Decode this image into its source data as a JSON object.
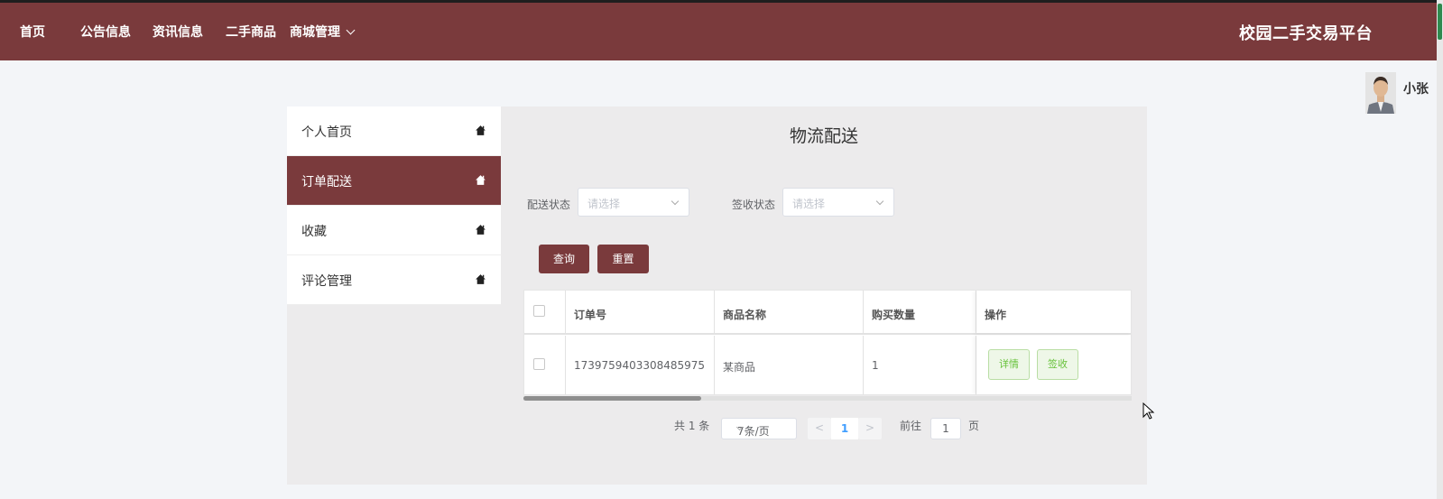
{
  "nav": {
    "home": "首页",
    "notice": "公告信息",
    "news": "资讯信息",
    "goods": "二手商品",
    "mall": "商城管理",
    "brand": "校园二手交易平台"
  },
  "user": {
    "name": "小张"
  },
  "sidebar": {
    "items": [
      {
        "label": "个人首页"
      },
      {
        "label": "订单配送"
      },
      {
        "label": "收藏"
      },
      {
        "label": "评论管理"
      }
    ]
  },
  "page": {
    "title": "物流配送"
  },
  "filters": {
    "delivery_label": "配送状态",
    "delivery_placeholder": "请选择",
    "receipt_label": "签收状态",
    "receipt_placeholder": "请选择",
    "query": "查询",
    "reset": "重置"
  },
  "table": {
    "headers": [
      "订单号",
      "商品名称",
      "购买数量",
      "操作"
    ],
    "rows": [
      {
        "order_no": "1739759403308485975",
        "product": "某商品",
        "qty": "1",
        "detail": "详情",
        "sign": "签收"
      }
    ]
  },
  "pagination": {
    "total": "共 1 条",
    "page_size": "7条/页",
    "current": "1",
    "goto_prefix": "前往",
    "goto_value": "1",
    "goto_suffix": "页",
    "prev": "<",
    "next": ">"
  },
  "colors": {
    "primary": "#7a3a3c",
    "success": "#67c23a",
    "link": "#409eff"
  }
}
